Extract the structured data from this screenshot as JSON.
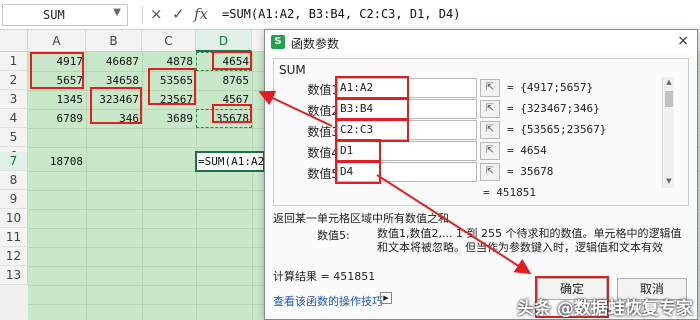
{
  "formula_bar": {
    "name_box": "SUM",
    "cancel_icon": "×",
    "confirm_icon": "✓",
    "fx_icon": "fx",
    "formula": "=SUM(A1:A2, B3:B4, C2:C3, D1, D4)"
  },
  "columns": [
    "A",
    "B",
    "C",
    "D"
  ],
  "rows": [
    "1",
    "2",
    "3",
    "4",
    "5",
    "6",
    "7",
    "8",
    "9",
    "10",
    "11",
    "12",
    "13"
  ],
  "cells": {
    "A1": "4917",
    "B1": "46687",
    "C1": "4878",
    "D1": "4654",
    "A2": "5657",
    "B2": "34658",
    "C2": "53565",
    "D2": "8765",
    "A3": "1345",
    "B3": "323467",
    "C3": "23567",
    "D3": "4567",
    "A4": "6789",
    "B4": "346",
    "C4": "3689",
    "D4": "35678",
    "A7": "18708",
    "D7": "=SUM(A1:A2,"
  },
  "dialog": {
    "title": "函数参数",
    "close_icon": "×",
    "function_name": "SUM",
    "args": [
      {
        "label": "数值1",
        "input": "A1:A2",
        "value": "= {4917;5657}"
      },
      {
        "label": "数值2",
        "input": "B3:B4",
        "value": "= {323467;346}"
      },
      {
        "label": "数值3",
        "input": "C2:C3",
        "value": "= {53565;23567}"
      },
      {
        "label": "数值4",
        "input": "D1",
        "value": "= 4654"
      },
      {
        "label": "数值5",
        "input": "D4",
        "value": "= 35678"
      }
    ],
    "total": "= 451851",
    "description": "返回某一单元格区域中所有数值之和",
    "arg_desc_label": "数值5:",
    "arg_desc_text": "数值1,数值2,... 1 到 255 个待求和的数值。单元格中的逻辑值和文本将被忽略。但当作为参数键入时，逻辑值和文本有效",
    "calc_result": "计算结果 = 451851",
    "help_link": "查看该函数的操作技巧",
    "ok_label": "确定",
    "cancel_label": "取消"
  },
  "watermark": "头条 @数据蛙恢复专家",
  "colors": {
    "grid_green": "#c9e8c9",
    "highlight_red": "#e02020",
    "excel_green": "#1e7145"
  }
}
